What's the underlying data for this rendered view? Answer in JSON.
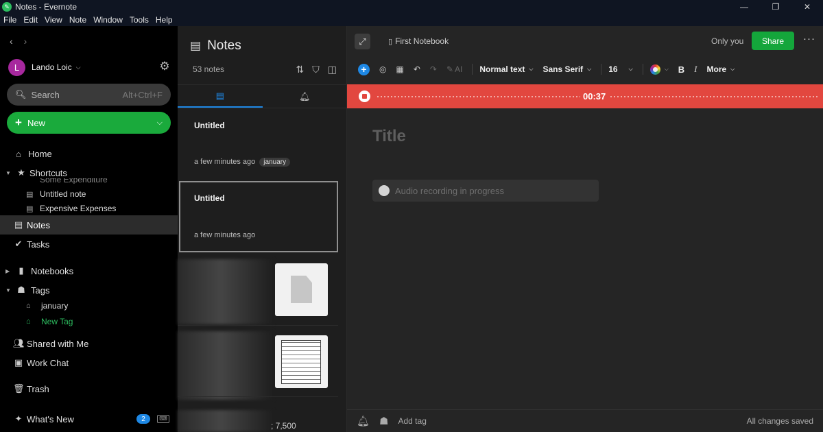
{
  "window": {
    "title": "Notes - Evernote",
    "controls": {
      "minimize": "—",
      "restore": "❐",
      "close": "✕"
    }
  },
  "menu": [
    "File",
    "Edit",
    "View",
    "Note",
    "Window",
    "Tools",
    "Help"
  ],
  "sidebar": {
    "user": {
      "initial": "L",
      "name": "Lando Loic",
      "avatar_color": "#a7289e"
    },
    "search": {
      "placeholder": "Search",
      "shortcut": "Alt+Ctrl+F"
    },
    "new_label": "New",
    "items": {
      "home": "Home",
      "shortcuts": "Shortcuts",
      "shortcut_clipped": "Some Expenditure",
      "shortcut_1": "Untitled note",
      "shortcut_2": "Expensive Expenses",
      "notes": "Notes",
      "tasks": "Tasks",
      "notebooks": "Notebooks",
      "tags": "Tags",
      "tag_1": "january",
      "tag_new": "New Tag",
      "shared": "Shared with Me",
      "workchat": "Work Chat",
      "trash": "Trash",
      "whats_new": "What's New",
      "whats_new_badge": "2"
    },
    "accent": "#2dbe60"
  },
  "notelist": {
    "title": "Notes",
    "count": "53 notes",
    "notes": [
      {
        "title": "Untitled",
        "date": "a few minutes ago",
        "tag": "january"
      },
      {
        "title": "Untitled",
        "date": "a few minutes ago"
      }
    ],
    "partial_text": "; 7,500"
  },
  "editor": {
    "notebook": "First Notebook",
    "sharing": "Only you",
    "share_label": "Share",
    "toolbar": {
      "ai": "AI",
      "style": "Normal text",
      "font": "Sans Serif",
      "size": "16",
      "bold": "B",
      "italic": "I",
      "more": "More"
    },
    "recording_time": "00:37",
    "title_placeholder": "Title",
    "audio_status": "Audio recording in progress",
    "add_tag": "Add tag",
    "save_status": "All changes saved"
  }
}
